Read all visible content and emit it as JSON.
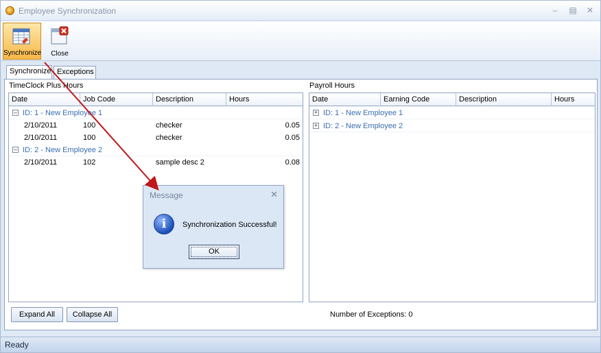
{
  "window": {
    "title": "Employee Synchronization"
  },
  "toolbar": {
    "synchronize_label": "Synchronize",
    "close_label": "Close"
  },
  "tabs": [
    {
      "label": "Synchronize",
      "active": true
    },
    {
      "label": "Exceptions",
      "active": false
    }
  ],
  "left_panel": {
    "title": "TimeClock Plus Hours",
    "columns": [
      "Date",
      "Job Code",
      "Description",
      "Hours"
    ],
    "groups": [
      {
        "label": "ID: 1 - New Employee 1",
        "rows": [
          {
            "date": "2/10/2011",
            "job_code": "100",
            "description": "checker",
            "hours": "0.05"
          },
          {
            "date": "2/10/2011",
            "job_code": "100",
            "description": "checker",
            "hours": "0.05"
          }
        ]
      },
      {
        "label": "ID: 2 - New Employee 2",
        "rows": [
          {
            "date": "2/10/2011",
            "job_code": "102",
            "description": "sample desc 2",
            "hours": "0.08"
          }
        ]
      }
    ]
  },
  "right_panel": {
    "title": "Payroll Hours",
    "columns": [
      "Date",
      "Earning Code",
      "Description",
      "Hours"
    ],
    "groups": [
      {
        "label": "ID: 1 - New Employee 1"
      },
      {
        "label": "ID: 2 - New Employee 2"
      }
    ]
  },
  "buttons": {
    "expand_all": "Expand All",
    "collapse_all": "Collapse All"
  },
  "exceptions_count": "Number of Exceptions: 0",
  "status": {
    "text": "Ready"
  },
  "dialog": {
    "title": "Message",
    "message": "Synchronization Successful!",
    "ok_label": "OK"
  },
  "colors": {
    "accent": "#3a6db3",
    "arrow": "#c0181a",
    "active_button": "#f9b84a"
  }
}
